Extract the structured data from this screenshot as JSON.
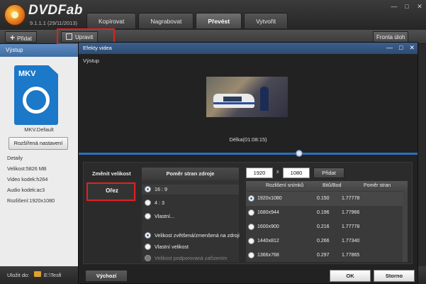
{
  "app": {
    "name": "DVDFab",
    "version": "9.1.1.1 (29/11/2013)"
  },
  "tabs": [
    {
      "label": "Kopírovat"
    },
    {
      "label": "Nagrabovat"
    },
    {
      "label": "Převést",
      "active": true
    },
    {
      "label": "Vytvořit"
    }
  ],
  "toolbar": {
    "add_label": "Přidat",
    "edit_label": "Upravit",
    "queue_label": "Fronta úloh"
  },
  "left_panel": {
    "header": "Výstup",
    "format_badge": "MKV",
    "profile_name": "MKV.Default",
    "advanced_button": "Rozšířená nastavení",
    "details_title": "Detaily",
    "details": [
      "Velikost:5826 MB",
      "Video kodek:h264",
      "Audio kodek:ac3",
      "Rozlišení:1920x1080"
    ]
  },
  "bottom": {
    "save_to_label": "Uložit do:",
    "save_path": "E:\\Tesfi"
  },
  "dialog": {
    "title": "Efekty videa",
    "output_label": "Výstup",
    "duration": "Délka(01:08:15)",
    "playback_position_fraction": 0.65,
    "change_size_label": "Změnit velikost",
    "crop_label": "Ořez",
    "aspect": {
      "header": "Poměr stran zdroje",
      "options": [
        "16 : 9",
        "4 : 3",
        "Vlastní..."
      ],
      "selected": "16 : 9",
      "scale_options": [
        "Velikost zvětšená/zmenšená na zdroji",
        "Vlastní velikost",
        "Velikost podporovaná zařízením"
      ],
      "scale_selected": "Velikost zvětšená/zmenšená na zdroji"
    },
    "width": "1920",
    "height": "1080",
    "times_sign": "x",
    "add_button": "Přidat",
    "table": {
      "headers": [
        "Rozlišení snímků",
        "Bitů/Bod",
        "Poměr stran"
      ],
      "rows": [
        {
          "res": "1920x1080",
          "bits": "0.150",
          "ratio": "1.77778",
          "selected": true
        },
        {
          "res": "1680x944",
          "bits": "0.196",
          "ratio": "1.77966"
        },
        {
          "res": "1600x900",
          "bits": "0.216",
          "ratio": "1.77778"
        },
        {
          "res": "1440x812",
          "bits": "0.266",
          "ratio": "1.77340"
        },
        {
          "res": "1366x768",
          "bits": "0.297",
          "ratio": "1.77865"
        }
      ]
    },
    "default_button": "Výchozí",
    "ok_button": "OK",
    "cancel_button": "Storno"
  },
  "colors": {
    "accent_blue": "#3d6ca3",
    "highlight_red": "#e02020",
    "format_blue": "#1c78c8"
  }
}
